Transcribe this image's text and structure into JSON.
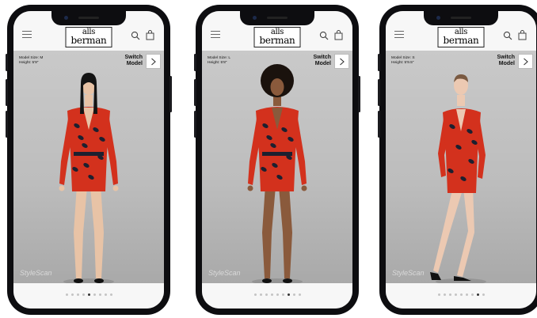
{
  "brand": {
    "logo_line1": "alls",
    "logo_line2": "berman",
    "watermark": "StyleScan"
  },
  "switch_label_line1": "Switch",
  "switch_label_line2": "Model",
  "screens": [
    {
      "model_size": "Model Size: M",
      "model_height": "Height: 5'9\"",
      "active_dot": 5,
      "pose": "front",
      "skin": "#e8c3a6",
      "hair": "#141414"
    },
    {
      "model_size": "Model Size: L",
      "model_height": "Height: 5'8\"",
      "active_dot": 7,
      "pose": "front",
      "skin": "#8a5a3c",
      "hair": "#1a120d"
    },
    {
      "model_size": "Model Size: S",
      "model_height": "Height: 5'9.5\"",
      "active_dot": 8,
      "pose": "side",
      "skin": "#ecc9b2",
      "hair": "#7a5a42"
    }
  ],
  "dot_count": 9,
  "colors": {
    "dress_red": "#d3311d",
    "dress_dark": "#1c2030"
  }
}
